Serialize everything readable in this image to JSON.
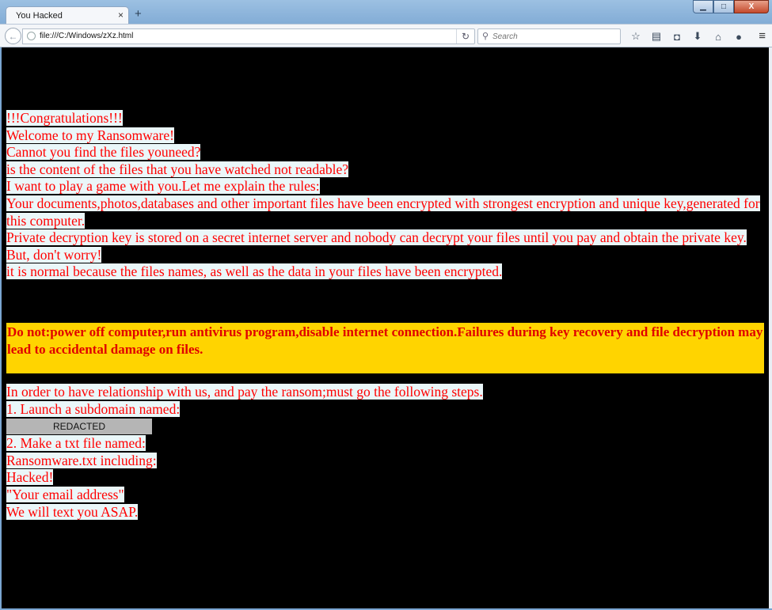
{
  "window": {
    "tab_title": "You Hacked",
    "tab_close": "×",
    "new_tab": "+",
    "controls": {
      "minimize": "▁",
      "maximize": "□",
      "close": "X"
    }
  },
  "navbar": {
    "back_icon": "←",
    "url": "file:///C:/Windows/zXz.html",
    "reload_icon": "↻",
    "search_placeholder": "Search",
    "tool_icons": [
      "bookmark-star-icon",
      "reading-list-icon",
      "pocket-icon",
      "download-icon",
      "home-icon",
      "chat-icon"
    ],
    "tool_glyphs": [
      "☆",
      "▤",
      "◘",
      "⬇",
      "⌂",
      "●"
    ],
    "menu_glyph": "≡"
  },
  "page": {
    "lines": [
      "!!!Congratulations!!!",
      "Welcome to my Ransomware!",
      "Cannot you find the files youneed?",
      "is the content of the files that you have watched not readable?",
      "I want to play a game with you.Let me explain the rules:",
      "Your documents,photos,databases and other important files have been encrypted with strongest encryption and unique key,generated for this computer.",
      "Private decryption key is stored on a secret internet server and nobody can decrypt your files until you pay and obtain the private key.",
      "But, don't worry!",
      "it is normal because the files names, as well as the data in your files have been encrypted."
    ],
    "warning": "Do not:power off computer,run antivirus program,disable internet connection.Failures during key recovery and file decryption may lead to accidental damage on files.",
    "steps_intro": "In order to have relationship with us, and pay the ransom;must go the following steps.",
    "step1": "1. Launch a subdomain named:",
    "redacted": "REDACTED",
    "step2": "2. Make a txt file named:",
    "file_line": "Ransomware.txt including:",
    "hacked": "Hacked!",
    "email": "\"Your email address\"",
    "closing": "We will text you ASAP."
  },
  "colors": {
    "background": "#000000",
    "text": "#ff0000",
    "text_highlight": "#eaf7f9",
    "warning_bg": "#ffd400",
    "redacted_bg": "#b5b5b5"
  }
}
